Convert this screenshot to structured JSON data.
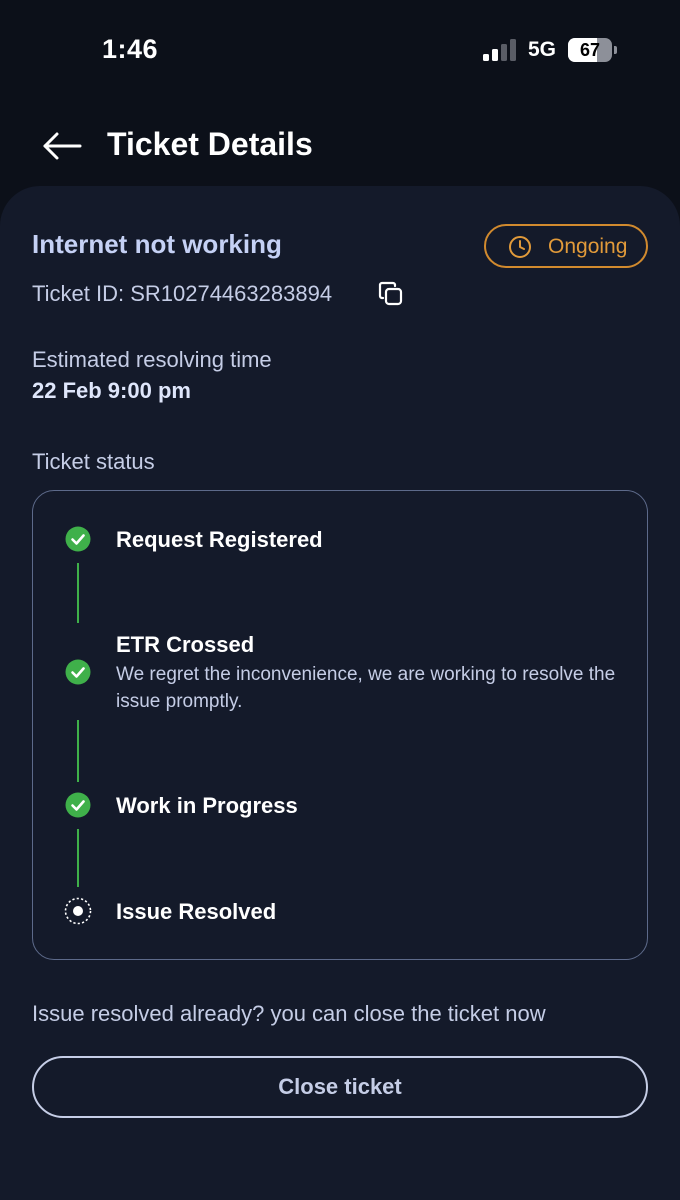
{
  "status_bar": {
    "time": "1:46",
    "network": "5G",
    "battery": 67,
    "battery_label": "67",
    "signal_bars_active": 2
  },
  "header": {
    "title": "Ticket Details",
    "back_icon": "arrow-left-icon"
  },
  "ticket": {
    "issue_title": "Internet not working",
    "status_label": "Ongoing",
    "status_icon": "clock-icon",
    "id_text": "Ticket ID: SR10274463283894",
    "copy_icon": "copy-icon",
    "eta_label": "Estimated resolving time",
    "eta_value": "22 Feb 9:00 pm"
  },
  "timeline": {
    "title": "Ticket status",
    "steps": [
      {
        "title": "Request Registered",
        "description": "",
        "state": "done"
      },
      {
        "title": "ETR Crossed",
        "description": "We regret the inconvenience, we are working to resolve the issue promptly.",
        "state": "done"
      },
      {
        "title": "Work in Progress",
        "description": "",
        "state": "done"
      },
      {
        "title": "Issue Resolved",
        "description": "",
        "state": "pending"
      }
    ]
  },
  "close": {
    "prompt": "Issue resolved already? you can close the ticket now",
    "button_label": "Close ticket"
  },
  "colors": {
    "background": "#0c1019",
    "card": "#141a2a",
    "accent_text": "#c5d1f5",
    "status_orange": "#e19a3a",
    "success_green": "#3fb04a"
  }
}
